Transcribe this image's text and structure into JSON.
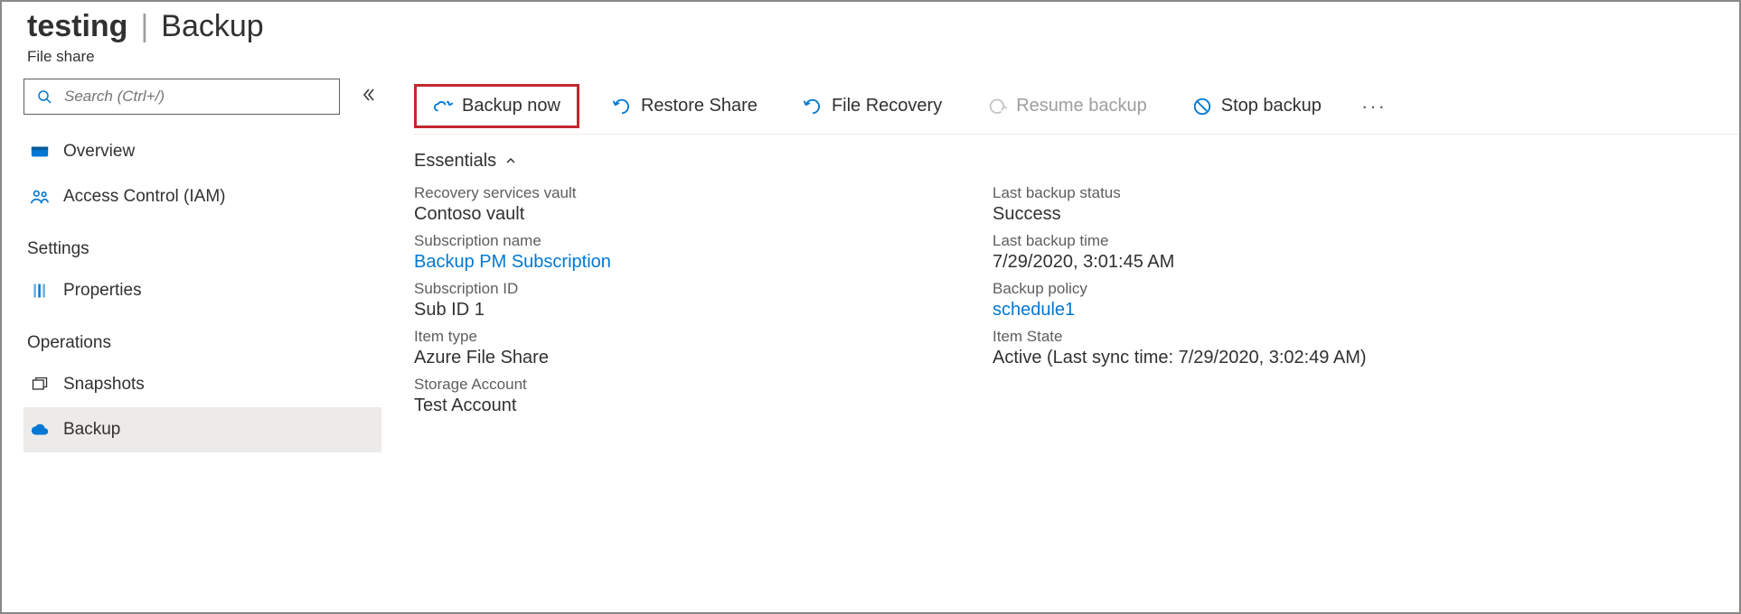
{
  "header": {
    "title_bold": "testing",
    "title_section": "Backup",
    "subtitle": "File share"
  },
  "search": {
    "placeholder": "Search (Ctrl+/)"
  },
  "sidebar": {
    "items": [
      {
        "label": "Overview"
      },
      {
        "label": "Access Control (IAM)"
      }
    ],
    "group_settings": "Settings",
    "settings_items": [
      {
        "label": "Properties"
      }
    ],
    "group_operations": "Operations",
    "operations_items": [
      {
        "label": "Snapshots"
      },
      {
        "label": "Backup"
      }
    ]
  },
  "toolbar": {
    "backup_now": "Backup now",
    "restore_share": "Restore Share",
    "file_recovery": "File Recovery",
    "resume_backup": "Resume backup",
    "stop_backup": "Stop backup"
  },
  "essentials": {
    "header": "Essentials",
    "left": [
      {
        "label": "Recovery services vault",
        "value": "Contoso vault",
        "link": false
      },
      {
        "label": "Subscription name",
        "value": "Backup PM Subscription",
        "link": true
      },
      {
        "label": "Subscription ID",
        "value": "Sub ID 1",
        "link": false
      },
      {
        "label": "Item type",
        "value": "Azure File Share",
        "link": false
      },
      {
        "label": "Storage Account",
        "value": "Test Account",
        "link": false
      }
    ],
    "right": [
      {
        "label": "Last backup status",
        "value": "Success",
        "link": false
      },
      {
        "label": "Last backup time",
        "value": "7/29/2020, 3:01:45 AM",
        "link": false
      },
      {
        "label": "Backup policy",
        "value": "schedule1",
        "link": true
      },
      {
        "label": "Item State",
        "value": "Active (Last sync time: 7/29/2020, 3:02:49 AM)",
        "link": false
      }
    ]
  }
}
